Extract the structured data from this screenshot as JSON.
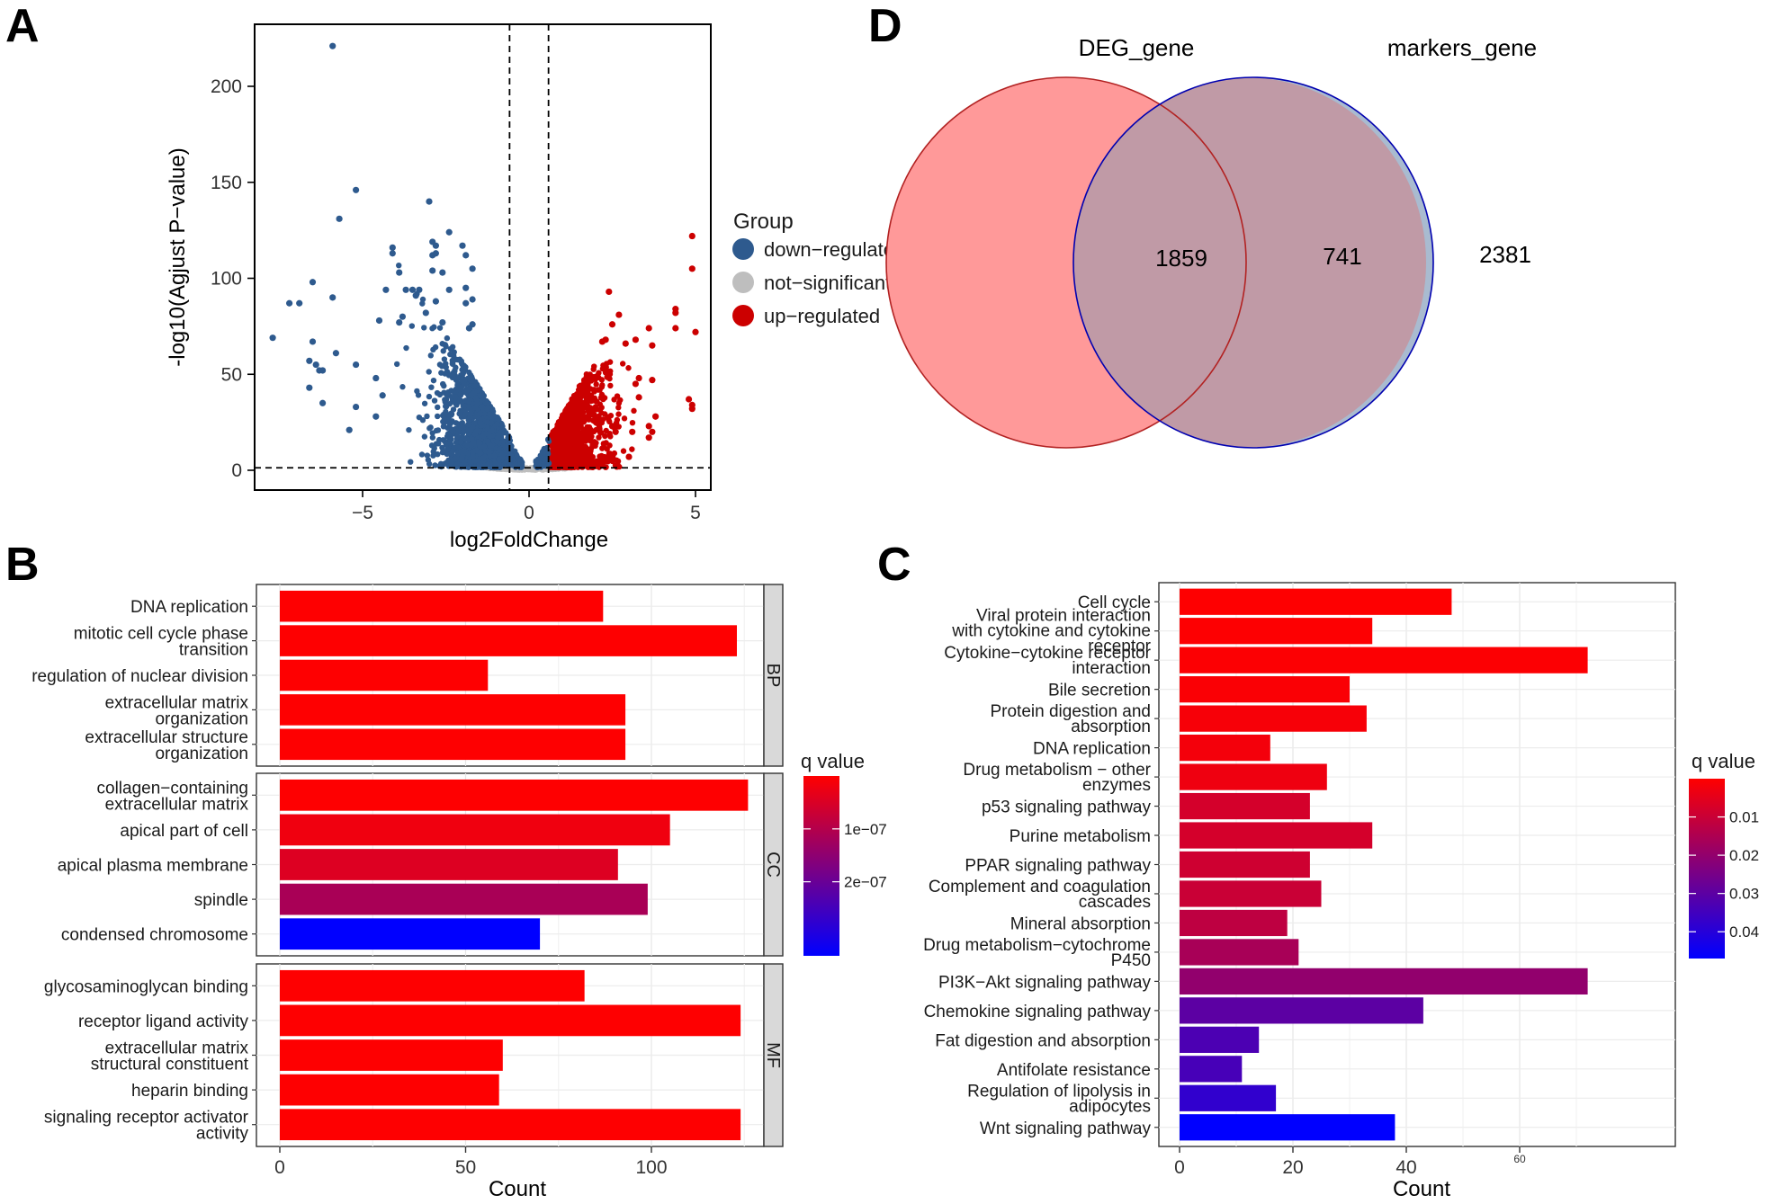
{
  "panel_labels": {
    "a": "A",
    "b": "B",
    "c": "C",
    "d": "D"
  },
  "chart_data": [
    {
      "id": "volcano",
      "type": "scatter",
      "title": "",
      "xlabel": "log2FoldChange",
      "ylabel": "-log10(Agjust P−value)",
      "xlim": [
        -8.2,
        5.7
      ],
      "ylim": [
        -10,
        230
      ],
      "x_ticks": [
        -5,
        0,
        5
      ],
      "x_tick_labels": [
        "−5",
        "0",
        "5"
      ],
      "y_ticks": [
        0,
        50,
        100,
        150,
        200
      ],
      "y_tick_labels": [
        "0",
        "50",
        "100",
        "150",
        "200"
      ],
      "thresholds": {
        "log2fc": [
          -0.585,
          0.585
        ],
        "neg_log10_p": 1.3
      },
      "grid": false,
      "legend": {
        "title": "Group",
        "placement": "right",
        "entries": [
          {
            "label": "down−regulated",
            "color": "#2E5A8E"
          },
          {
            "label": "not−significant",
            "color": "#BEBEBE"
          },
          {
            "label": "up−regulated",
            "color": "#CC0000"
          }
        ]
      },
      "highlight_points": {
        "down": [
          [
            -5.9,
            221
          ],
          [
            -5.2,
            146
          ],
          [
            -5.7,
            131
          ],
          [
            -3.0,
            140
          ],
          [
            -6.5,
            98
          ],
          [
            -7.2,
            87
          ],
          [
            -6.9,
            87
          ],
          [
            -5.9,
            90
          ],
          [
            -7.7,
            69
          ],
          [
            -6.5,
            67
          ],
          [
            -6.6,
            57
          ],
          [
            -5.8,
            61
          ],
          [
            -6.3,
            52
          ],
          [
            -6.4,
            55
          ],
          [
            -6.2,
            52
          ],
          [
            -6.6,
            43
          ],
          [
            -5.2,
            55
          ],
          [
            -6.2,
            35
          ],
          [
            -5.2,
            33
          ],
          [
            -5.4,
            21
          ],
          [
            -4.6,
            48
          ],
          [
            -4.4,
            39
          ],
          [
            -4.6,
            28
          ],
          [
            -4.1,
            116
          ],
          [
            -4.1,
            113
          ],
          [
            -2.4,
            124
          ],
          [
            -2.9,
            119
          ],
          [
            -2.8,
            117
          ],
          [
            -2.0,
            117
          ],
          [
            -1.9,
            112
          ],
          [
            -2.9,
            112
          ],
          [
            -2.8,
            113
          ],
          [
            -1.7,
            105
          ],
          [
            -3.9,
            103
          ],
          [
            -2.6,
            103
          ],
          [
            -2.9,
            104
          ],
          [
            -4.3,
            94
          ],
          [
            -3.7,
            94
          ],
          [
            -3.5,
            94
          ],
          [
            -3.3,
            94
          ],
          [
            -2.4,
            94
          ],
          [
            -1.9,
            95
          ],
          [
            -3.4,
            91
          ],
          [
            -1.7,
            89
          ],
          [
            -1.9,
            87
          ],
          [
            -2.8,
            88
          ],
          [
            -3.1,
            82
          ],
          [
            -4.5,
            78
          ],
          [
            -3.8,
            80
          ],
          [
            -3.9,
            77
          ],
          [
            -2.6,
            77
          ],
          [
            -1.7,
            76
          ],
          [
            -1.8,
            74
          ]
        ],
        "up": [
          [
            4.9,
            122
          ],
          [
            4.9,
            105
          ],
          [
            2.4,
            93
          ],
          [
            4.4,
            84
          ],
          [
            4.4,
            82
          ],
          [
            2.7,
            81
          ],
          [
            2.5,
            76
          ],
          [
            4.4,
            74
          ],
          [
            3.6,
            74
          ],
          [
            5.0,
            72
          ],
          [
            2.3,
            68
          ],
          [
            2.2,
            67
          ],
          [
            3.2,
            68
          ],
          [
            2.9,
            66
          ],
          [
            3.7,
            65
          ],
          [
            4.8,
            37
          ],
          [
            4.9,
            34
          ],
          [
            4.9,
            32
          ],
          [
            3.3,
            48
          ],
          [
            3.7,
            47
          ],
          [
            3.2,
            45
          ],
          [
            3.3,
            38
          ],
          [
            3.8,
            28
          ],
          [
            3.6,
            23
          ],
          [
            3.7,
            20
          ],
          [
            3.6,
            17
          ],
          [
            3.1,
            20
          ],
          [
            2.5,
            23
          ],
          [
            2.6,
            20
          ],
          [
            3.0,
            7
          ]
        ]
      },
      "dense_cloud": {
        "down_count": 1400,
        "up_count": 1300,
        "ns_count": 250,
        "seed": 42
      }
    },
    {
      "id": "go_enrichment",
      "type": "bar",
      "orientation": "horizontal",
      "xlabel": "Count",
      "ylabel": "",
      "xlim": [
        -7,
        131
      ],
      "x_ticks": [
        0,
        50,
        100
      ],
      "grid": true,
      "facets": [
        {
          "name": "BP",
          "categories": [
            "DNA replication",
            "mitotic cell cycle phase\ntransition",
            "regulation of nuclear division",
            "extracellular matrix\norganization",
            "extracellular structure\norganization"
          ],
          "values": [
            87,
            123,
            56,
            93,
            93
          ],
          "qvalues": [
            1e-09,
            1e-09,
            1e-09,
            1e-09,
            1e-09
          ]
        },
        {
          "name": "CC",
          "categories": [
            "collagen−containing\nextracellular matrix",
            "apical part of cell",
            "apical plasma membrane",
            "spindle",
            "condensed chromosome"
          ],
          "values": [
            126,
            105,
            91,
            99,
            70
          ],
          "qvalues": [
            1e-09,
            2e-08,
            4.5e-08,
            1.15e-07,
            3.4e-07
          ]
        },
        {
          "name": "MF",
          "categories": [
            "glycosaminoglycan binding",
            "receptor ligand activity",
            "extracellular matrix\nstructural constituent",
            "heparin binding",
            "signaling receptor activator\nactivity"
          ],
          "values": [
            82,
            124,
            60,
            59,
            124
          ],
          "qvalues": [
            1e-09,
            1e-09,
            1e-09,
            1e-09,
            1e-09
          ]
        }
      ],
      "legend": {
        "title": "q value",
        "placement": "right",
        "low_color": "#FF0000",
        "high_color": "#0000FF",
        "range": [
          0,
          3.4e-07
        ],
        "ticks": [
          1e-07,
          2e-07
        ],
        "tick_labels": [
          "1e−07",
          "2e−07"
        ]
      }
    },
    {
      "id": "kegg_enrichment",
      "type": "bar",
      "orientation": "horizontal",
      "xlabel": "Count",
      "ylabel": "",
      "xlim": [
        -3.6,
        75.6
      ],
      "x_ticks": [
        0,
        20,
        40,
        60
      ],
      "x_tick_labels": [
        "0",
        "20",
        "40",
        "60"
      ],
      "grid": true,
      "categories": [
        "Cell cycle",
        "Viral protein interaction\nwith cytokine and cytokine\nreceptor",
        "Cytokine−cytokine receptor\ninteraction",
        "Bile secretion",
        "Protein digestion and\nabsorption",
        "DNA replication",
        "Drug metabolism − other\nenzymes",
        "p53 signaling pathway",
        "Purine metabolism",
        "PPAR signaling pathway",
        "Complement and coagulation\ncascades",
        "Mineral absorption",
        "Drug metabolism−cytochrome\nP450",
        "PI3K−Akt signaling pathway",
        "Chemokine signaling pathway",
        "Fat digestion and absorption",
        "Antifolate resistance",
        "Regulation of lipolysis in\nadipocytes",
        "Wnt signaling pathway"
      ],
      "values": [
        48,
        34,
        72,
        30,
        33,
        16,
        26,
        23,
        34,
        23,
        25,
        19,
        21,
        72,
        43,
        14,
        11,
        17,
        38
      ],
      "qvalues": [
        0.0002,
        0.0004,
        0.0005,
        0.001,
        0.0015,
        0.002,
        0.003,
        0.008,
        0.008,
        0.009,
        0.01,
        0.012,
        0.016,
        0.02,
        0.03,
        0.033,
        0.034,
        0.038,
        0.047
      ],
      "legend": {
        "title": "q value",
        "placement": "right",
        "low_color": "#FF0000",
        "high_color": "#0000FF",
        "range": [
          0.0,
          0.047
        ],
        "ticks": [
          0.01,
          0.02,
          0.03,
          0.04
        ],
        "tick_labels": [
          "0.01",
          "0.02",
          "0.03",
          "0.04"
        ]
      }
    },
    {
      "id": "venn",
      "type": "venn",
      "sets": [
        {
          "name": "DEG_gene",
          "only": 1859,
          "fill": "#FF9999",
          "stroke": "#B22222"
        },
        {
          "name": "markers_gene",
          "only": 2381,
          "fill": "#A9BBD0",
          "stroke": "#0000B0"
        }
      ],
      "intersection": 741
    }
  ]
}
